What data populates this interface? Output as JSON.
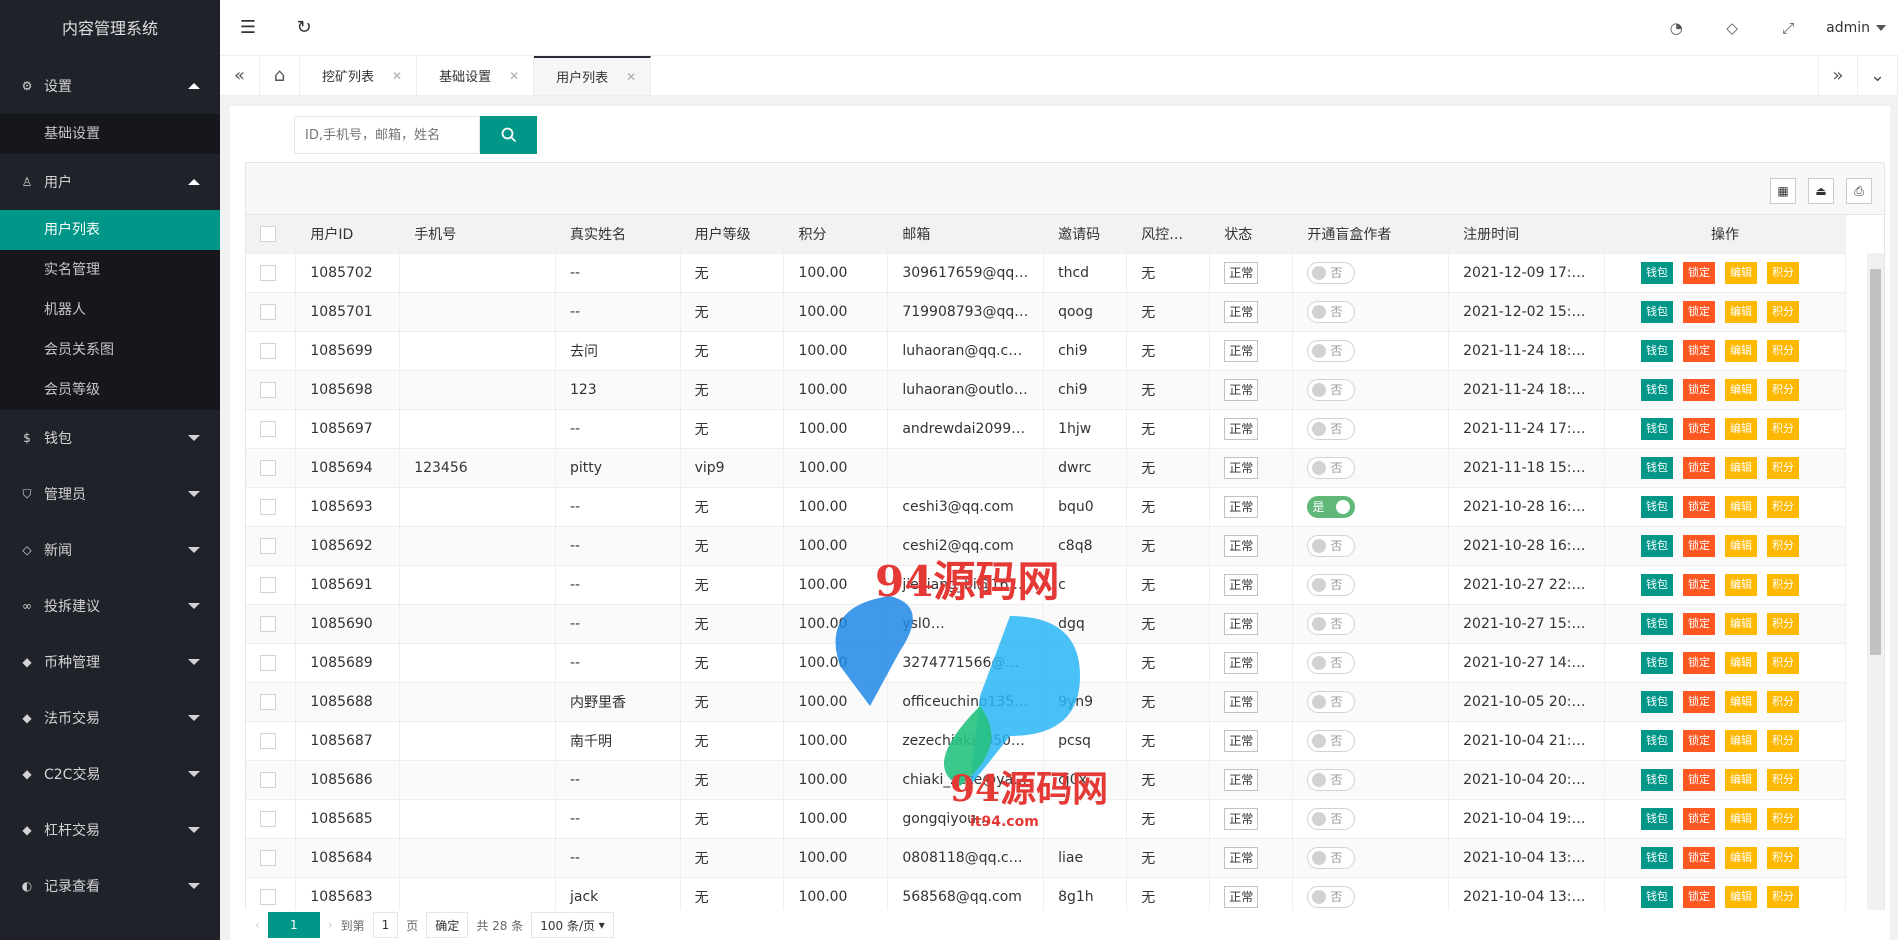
{
  "sidebar": {
    "title": "内容管理系统",
    "groups": [
      {
        "label": "设置",
        "icon": "gear-icon",
        "expanded": true,
        "items": [
          "基础设置"
        ]
      },
      {
        "label": "用户",
        "icon": "user-icon",
        "expanded": true,
        "items": [
          "用户列表",
          "实名管理",
          "机器人",
          "会员关系图",
          "会员等级"
        ]
      },
      {
        "label": "钱包",
        "icon": "coin-icon",
        "expanded": false
      },
      {
        "label": "管理员",
        "icon": "shield-icon",
        "expanded": false
      },
      {
        "label": "新闻",
        "icon": "tag-icon",
        "expanded": false
      },
      {
        "label": "投拆建议",
        "icon": "link-icon",
        "expanded": false
      },
      {
        "label": "币种管理",
        "icon": "diamond-icon",
        "expanded": false
      },
      {
        "label": "法币交易",
        "icon": "diamond-icon",
        "expanded": false
      },
      {
        "label": "C2C交易",
        "icon": "diamond-icon",
        "expanded": false
      },
      {
        "label": "杠杆交易",
        "icon": "diamond-icon",
        "expanded": false
      },
      {
        "label": "记录查看",
        "icon": "record-icon",
        "expanded": false
      }
    ],
    "active_item": "用户列表"
  },
  "topbar": {
    "user": "admin"
  },
  "tabs": [
    {
      "label": "挖矿列表"
    },
    {
      "label": "基础设置"
    },
    {
      "label": "用户列表",
      "active": true
    }
  ],
  "search": {
    "placeholder": "ID,手机号，邮箱，姓名"
  },
  "table": {
    "columns": [
      "用户ID",
      "手机号",
      "真实姓名",
      "用户等级",
      "积分",
      "邮箱",
      "邀请码",
      "风控…",
      "状态",
      "开通盲盒作者",
      "注册时间",
      "操作"
    ],
    "actions": [
      "钱包",
      "锁定",
      "编辑",
      "积分"
    ],
    "switch_off": "否",
    "switch_on": "是",
    "rows": [
      {
        "id": "1085702",
        "phone": "",
        "name": "--",
        "level": "无",
        "points": "100.00",
        "email": "309617659@qq.…",
        "code": "thcd",
        "risk": "无",
        "status": "正常",
        "author": false,
        "time": "2021-12-09 17:1…"
      },
      {
        "id": "1085701",
        "phone": "",
        "name": "--",
        "level": "无",
        "points": "100.00",
        "email": "719908793@qq.…",
        "code": "qoog",
        "risk": "无",
        "status": "正常",
        "author": false,
        "time": "2021-12-02 15:5…"
      },
      {
        "id": "1085699",
        "phone": "",
        "name": "去问",
        "level": "无",
        "points": "100.00",
        "email": "luhaoran@qq.com",
        "code": "chi9",
        "risk": "无",
        "status": "正常",
        "author": false,
        "time": "2021-11-24 18:0…"
      },
      {
        "id": "1085698",
        "phone": "",
        "name": "123",
        "level": "无",
        "points": "100.00",
        "email": "luhaoran@outlo…",
        "code": "chi9",
        "risk": "无",
        "status": "正常",
        "author": false,
        "time": "2021-11-24 18:0…"
      },
      {
        "id": "1085697",
        "phone": "",
        "name": "--",
        "level": "无",
        "points": "100.00",
        "email": "andrewdai2099…",
        "code": "1hjw",
        "risk": "无",
        "status": "正常",
        "author": false,
        "time": "2021-11-24 17:5…"
      },
      {
        "id": "1085694",
        "phone": "123456",
        "name": "pitty",
        "level": "vip9",
        "points": "100.00",
        "email": "",
        "code": "dwrc",
        "risk": "无",
        "status": "正常",
        "author": false,
        "time": "2021-11-18 15:4…"
      },
      {
        "id": "1085693",
        "phone": "",
        "name": "--",
        "level": "无",
        "points": "100.00",
        "email": "ceshi3@qq.com",
        "code": "bqu0",
        "risk": "无",
        "status": "正常",
        "author": true,
        "time": "2021-10-28 16:4…"
      },
      {
        "id": "1085692",
        "phone": "",
        "name": "--",
        "level": "无",
        "points": "100.00",
        "email": "ceshi2@qq.com",
        "code": "c8q8",
        "risk": "无",
        "status": "正常",
        "author": false,
        "time": "2021-10-28 16:4…"
      },
      {
        "id": "1085691",
        "phone": "",
        "name": "--",
        "level": "无",
        "points": "100.00",
        "email": "jiexiang_bi@163…",
        "code": "c",
        "risk": "无",
        "status": "正常",
        "author": false,
        "time": "2021-10-27 22:5…"
      },
      {
        "id": "1085690",
        "phone": "",
        "name": "--",
        "level": "无",
        "points": "100.00",
        "email": "ysl0…",
        "code": "dgq",
        "risk": "无",
        "status": "正常",
        "author": false,
        "time": "2021-10-27 15:4…"
      },
      {
        "id": "1085689",
        "phone": "",
        "name": "--",
        "level": "无",
        "points": "100.00",
        "email": "3274771566@…",
        "code": "",
        "risk": "无",
        "status": "正常",
        "author": false,
        "time": "2021-10-27 14:3…"
      },
      {
        "id": "1085688",
        "phone": "",
        "name": "内野里香",
        "level": "无",
        "points": "100.00",
        "email": "officeuchino1352…",
        "code": "9yn9",
        "risk": "无",
        "status": "正常",
        "author": false,
        "time": "2021-10-05 20:3…"
      },
      {
        "id": "1085687",
        "phone": "",
        "name": "南千明",
        "level": "无",
        "points": "100.00",
        "email": "zezechiaki4050…",
        "code": "pcsq",
        "risk": "无",
        "status": "正常",
        "author": false,
        "time": "2021-10-04 21:5…"
      },
      {
        "id": "1085686",
        "phone": "",
        "name": "--",
        "level": "无",
        "points": "100.00",
        "email": "chiaki_zeze@ya…",
        "code": "cj0x",
        "risk": "无",
        "status": "正常",
        "author": false,
        "time": "2021-10-04 20:1…"
      },
      {
        "id": "1085685",
        "phone": "",
        "name": "--",
        "level": "无",
        "points": "100.00",
        "email": "gongqiyou…",
        "code": "",
        "risk": "无",
        "status": "正常",
        "author": false,
        "time": "2021-10-04 19:5…"
      },
      {
        "id": "1085684",
        "phone": "",
        "name": "--",
        "level": "无",
        "points": "100.00",
        "email": "0808118@qq.com",
        "code": "liae",
        "risk": "无",
        "status": "正常",
        "author": false,
        "time": "2021-10-04 13:4…"
      },
      {
        "id": "1085683",
        "phone": "",
        "name": "jack",
        "level": "无",
        "points": "100.00",
        "email": "568568@qq.com",
        "code": "8g1h",
        "risk": "无",
        "status": "正常",
        "author": false,
        "time": "2021-10-04 13:4…"
      }
    ]
  },
  "pager": {
    "current": "1",
    "goto_label": "到第",
    "page_value": "1",
    "page_suffix": "页",
    "confirm": "确定",
    "total": "共 28 条",
    "per_page": "100 条/页"
  },
  "watermark": {
    "text1": "94源码网",
    "text2": "94源码网",
    "domain": "it94.com"
  },
  "colors": {
    "sidebar_bg": "#20222a",
    "accent": "#009688",
    "danger": "#ff5722",
    "warn": "#ffb800",
    "switch_on": "#5fb878"
  }
}
